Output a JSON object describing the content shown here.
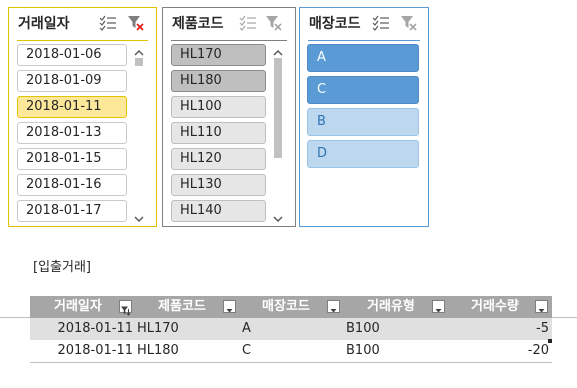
{
  "slicers": {
    "date": {
      "title": "거래일자",
      "icons": [
        "multi-select-icon",
        "clear-filter-icon"
      ],
      "items": [
        {
          "label": "2018-01-06",
          "selected": false
        },
        {
          "label": "2018-01-09",
          "selected": false
        },
        {
          "label": "2018-01-11",
          "selected": true
        },
        {
          "label": "2018-01-13",
          "selected": false
        },
        {
          "label": "2018-01-15",
          "selected": false
        },
        {
          "label": "2018-01-16",
          "selected": false
        },
        {
          "label": "2018-01-17",
          "selected": false
        }
      ]
    },
    "product": {
      "title": "제품코드",
      "icons": [
        "multi-select-icon",
        "clear-filter-icon"
      ],
      "items": [
        {
          "label": "HL170",
          "selected": true
        },
        {
          "label": "HL180",
          "selected": true
        },
        {
          "label": "HL100",
          "selected": false
        },
        {
          "label": "HL110",
          "selected": false
        },
        {
          "label": "HL120",
          "selected": false
        },
        {
          "label": "HL130",
          "selected": false
        },
        {
          "label": "HL140",
          "selected": false
        }
      ]
    },
    "store": {
      "title": "매장코드",
      "icons": [
        "multi-select-icon",
        "clear-filter-icon"
      ],
      "items": [
        {
          "label": "A",
          "selected": true
        },
        {
          "label": "C",
          "selected": true
        },
        {
          "label": "B",
          "selected": false
        },
        {
          "label": "D",
          "selected": false
        }
      ]
    }
  },
  "section_label": "[입출거래]",
  "table": {
    "headers": [
      "거래일자",
      "제품코드",
      "매장코드",
      "거래유형",
      "거래수량"
    ],
    "rows": [
      [
        "2018-01-11",
        "HL170",
        "A",
        "B100",
        "-5"
      ],
      [
        "2018-01-11",
        "HL180",
        "C",
        "B100",
        "-20"
      ]
    ]
  },
  "colors": {
    "date_accent": "#e3c200",
    "date_selected": "#fde89a",
    "product_selected": "#bfbfbf",
    "store_selected": "#5b9bd5",
    "store_unselected": "#bdd7ee",
    "table_header": "#a6a6a6"
  }
}
